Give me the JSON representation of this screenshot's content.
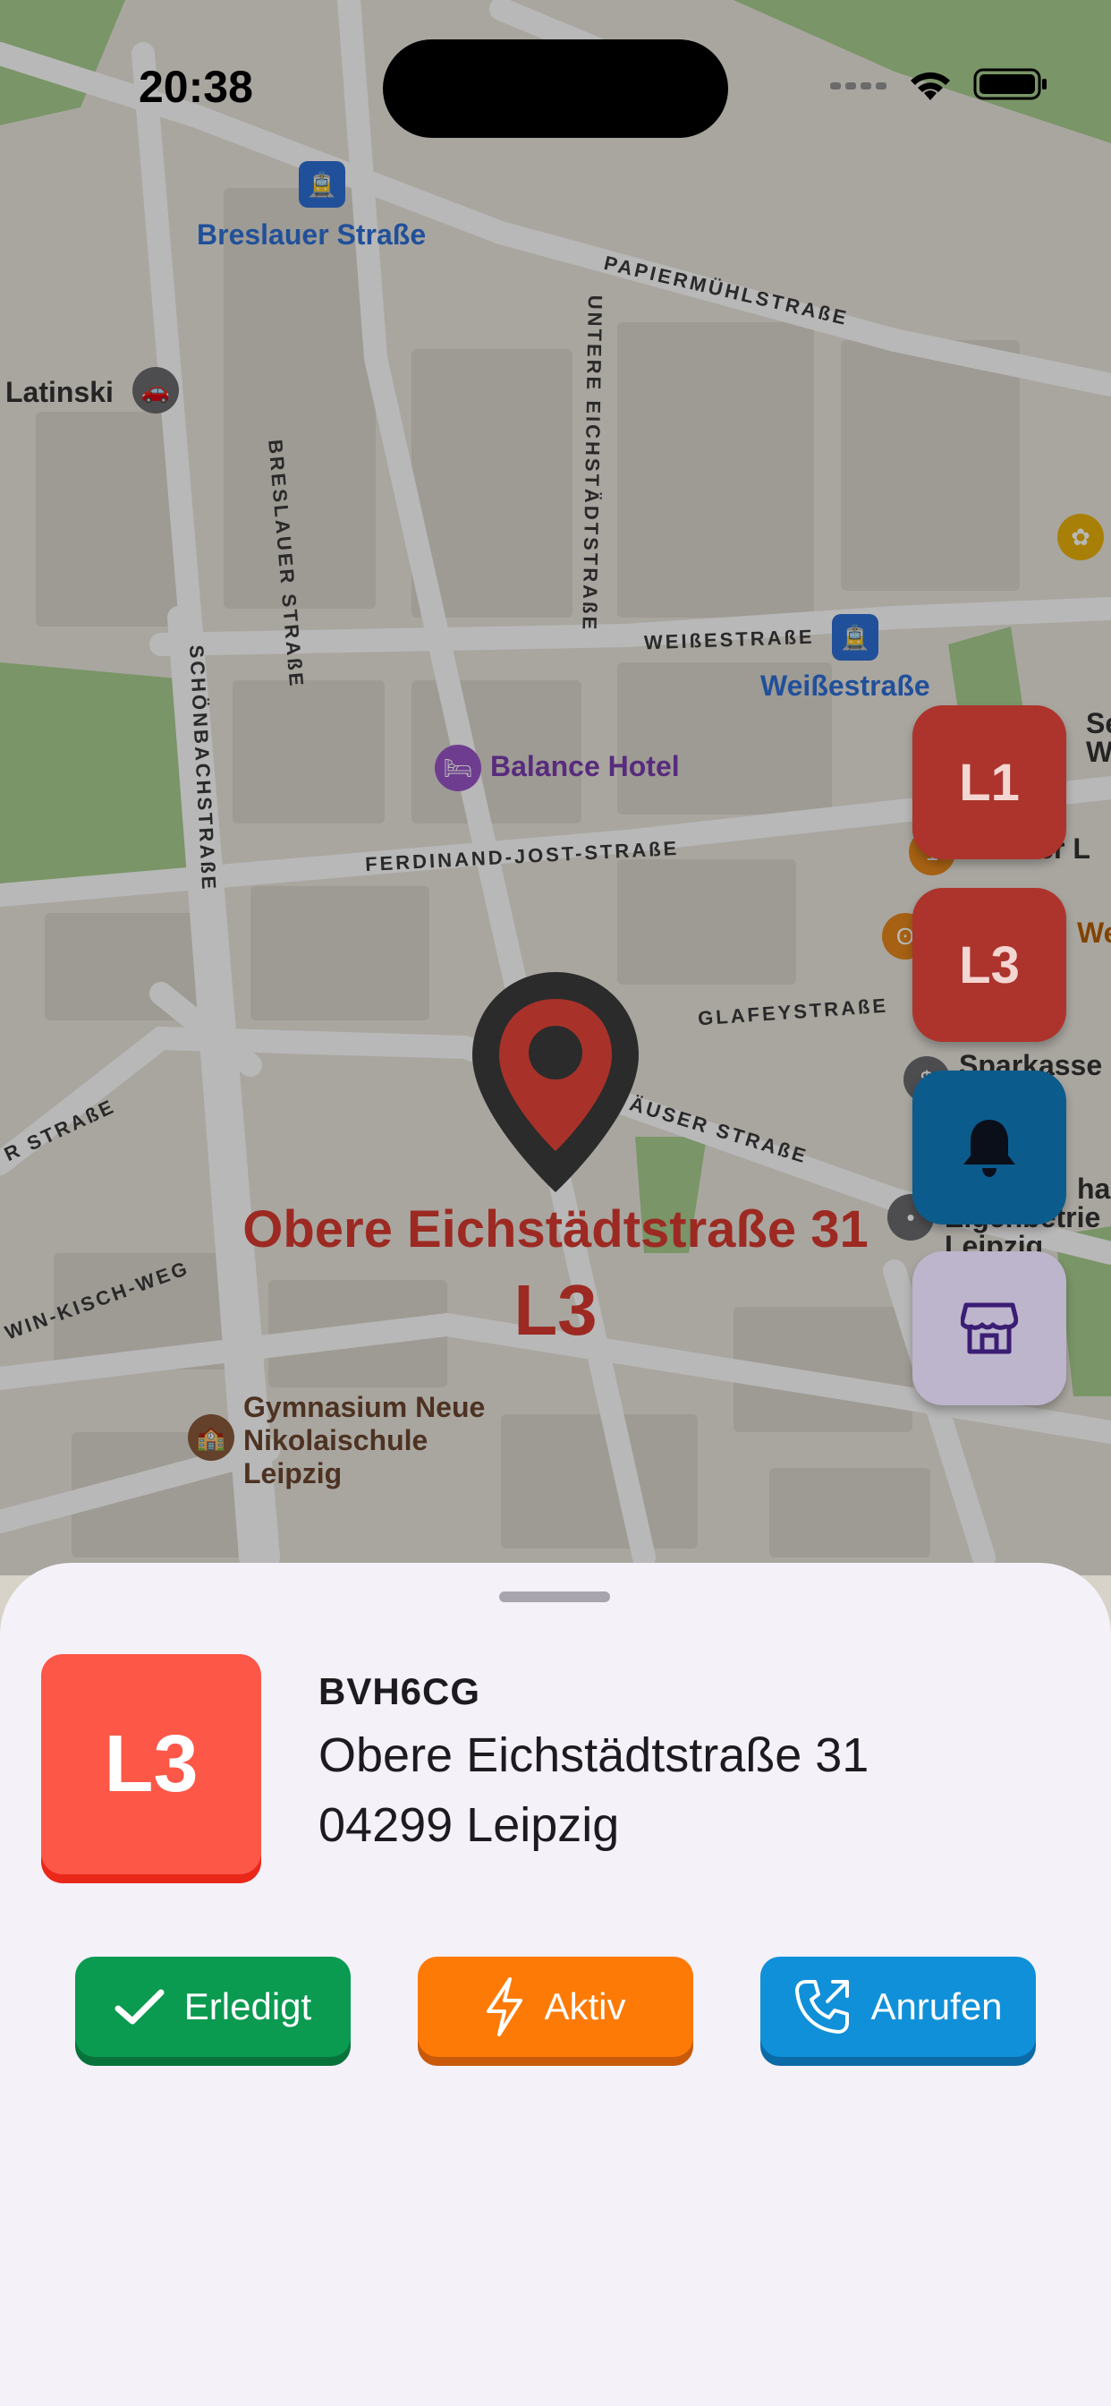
{
  "status_bar": {
    "time": "20:38"
  },
  "map": {
    "streets": [
      "BRESLAUER STRAßE",
      "UNTERE EICHSTÄDTSTRAßE",
      "PAPIERMÜHLSTRAßE",
      "SCHÖNBACHSTRAßE",
      "WEIßESTRAßE",
      "FERDINAND-JOST-STRAßE",
      "GLAFEYSTRAßE",
      "ÄUSER STRAßE",
      "R STRAßE",
      "WIN-KISCH-WEG"
    ],
    "pois": {
      "breslauer": "Breslauer Straße",
      "latinski": "Latinski",
      "weisse": "Weißestraße",
      "hotel": "Balance Hotel",
      "gymnasium_1": "Gymnasium Neue",
      "gymnasium_2": "Nikolaischule",
      "gymnasium_3": "Leipzig",
      "sparkasse": "Sparkasse",
      "stuetzer": "Stützer L",
      "we": "We",
      "sw1": "Se",
      "sw2": "W",
      "eigen": "Eigenbetrie",
      "leipzig_r": "Leipzig",
      "ehale": "hale"
    },
    "marker": {
      "address": "Obere Eichstädtstraße 31",
      "code": "L3",
      "color": "#2b2b2b",
      "pin_color": "#a8322a"
    }
  },
  "fabs": {
    "l1": "L1",
    "l3": "L3",
    "bell_icon": "bell-icon",
    "store_icon": "store-icon"
  },
  "sheet": {
    "badge": "L3",
    "code": "BVH6CG",
    "street": "Obere Eichstädtstraße 31",
    "city": "04299 Leipzig",
    "buttons": {
      "done": "Erledigt",
      "active": "Aktiv",
      "call": "Anrufen"
    },
    "colors": {
      "done": "#0a9a50",
      "active": "#fe7a06",
      "call": "#1090d9",
      "badge": "#fd5748"
    }
  }
}
